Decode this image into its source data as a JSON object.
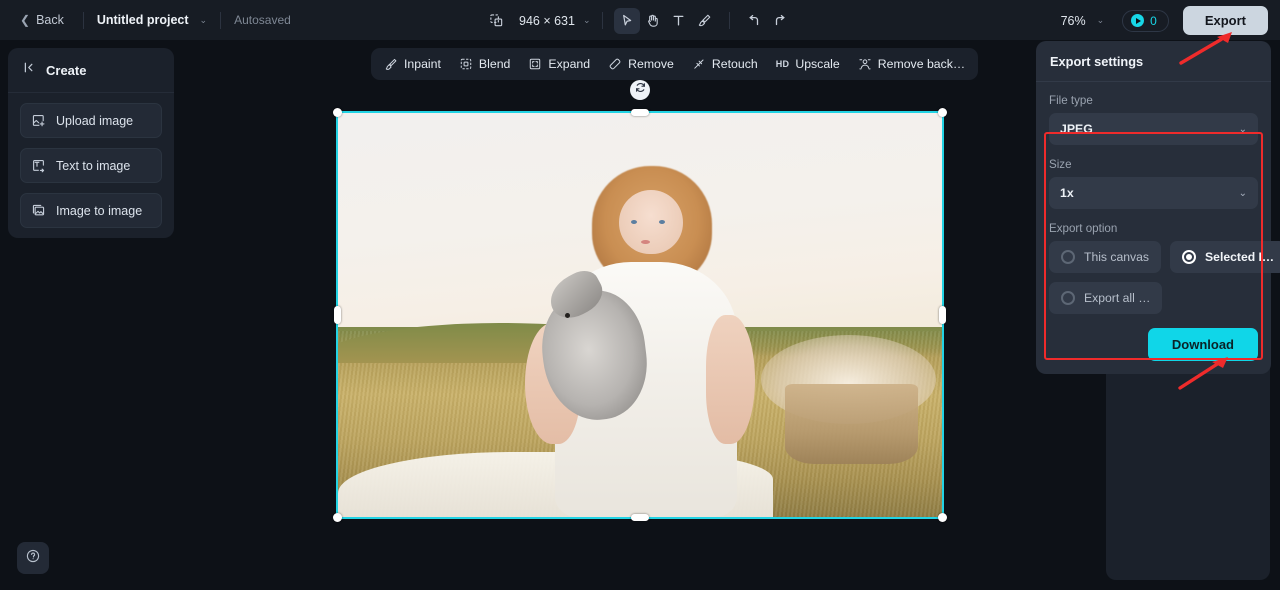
{
  "topbar": {
    "back_label": "Back",
    "project_name": "Untitled project",
    "autosaved_label": "Autosaved",
    "canvas_dimensions": "946 × 631",
    "tools": [
      {
        "name": "select-tool",
        "icon": "cursor-arrow-icon",
        "active": true
      },
      {
        "name": "hand-tool",
        "icon": "hand-icon",
        "active": false
      },
      {
        "name": "text-tool",
        "icon": "text-t-icon",
        "active": false
      },
      {
        "name": "brush-tool",
        "icon": "brush-icon",
        "active": false
      },
      {
        "name": "undo",
        "icon": "undo-arrow-icon",
        "active": false
      },
      {
        "name": "redo",
        "icon": "redo-arrow-icon",
        "active": false
      }
    ],
    "resize_icon": "resize-frame-icon",
    "zoom_level": "76%",
    "credits_count": "0",
    "credits_icon": "coin-icon",
    "export_label": "Export"
  },
  "sidebar": {
    "title": "Create",
    "collapse_icon": "collapse-left-icon",
    "items": [
      {
        "label": "Upload image",
        "icon": "upload-image-icon"
      },
      {
        "label": "Text to image",
        "icon": "text-to-image-icon"
      },
      {
        "label": "Image to image",
        "icon": "image-to-image-icon"
      }
    ],
    "help_icon": "help-question-icon"
  },
  "floating_toolbar": {
    "items": [
      {
        "label": "Inpaint",
        "icon": "inpaint-brush-icon"
      },
      {
        "label": "Blend",
        "icon": "blend-icon"
      },
      {
        "label": "Expand",
        "icon": "expand-frame-icon"
      },
      {
        "label": "Remove",
        "icon": "eraser-icon"
      },
      {
        "label": "Retouch",
        "icon": "retouch-icon"
      },
      {
        "label": "Upscale",
        "icon": "hd-upscale-icon",
        "badge": "HD"
      },
      {
        "label": "Remove back…",
        "icon": "remove-background-icon"
      }
    ]
  },
  "canvas": {
    "selection_color": "#22d3e4",
    "rotate_handle_icon": "rotate-icon",
    "image_alt": "Young girl in white dress holding a grey rabbit in a golden field"
  },
  "export_panel": {
    "title": "Export settings",
    "file_type": {
      "label": "File type",
      "value": "JPEG",
      "chevron_icon": "chevron-down-icon"
    },
    "size": {
      "label": "Size",
      "value": "1x",
      "chevron_icon": "chevron-down-icon"
    },
    "export_option": {
      "label": "Export option",
      "options": [
        {
          "label": "This canvas",
          "selected": false
        },
        {
          "label": "Selected I…",
          "selected": true
        },
        {
          "label": "Export all …",
          "selected": false
        }
      ]
    },
    "download_label": "Download",
    "highlight_color": "#ef2b2b",
    "accent_color": "#10d6e8"
  }
}
